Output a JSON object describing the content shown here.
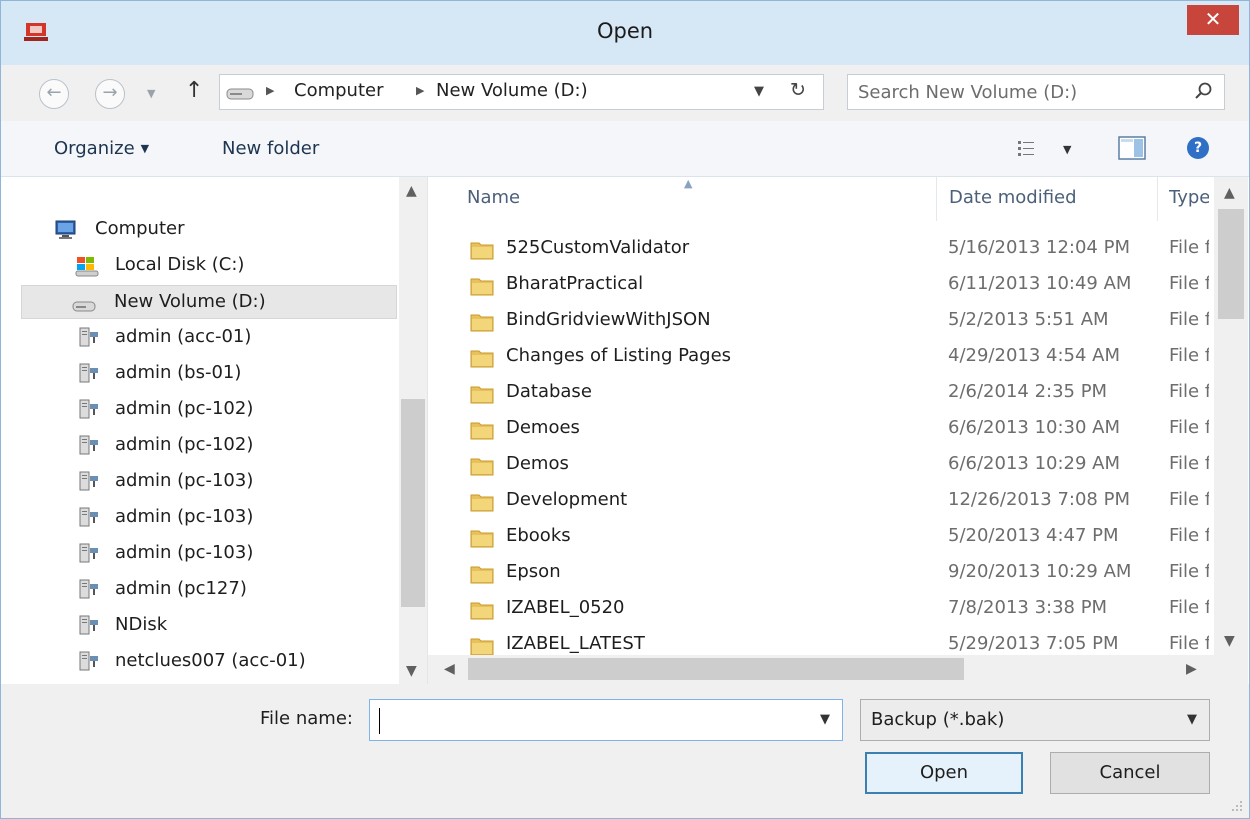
{
  "window": {
    "title": "Open",
    "close_glyph": "✕"
  },
  "addressbar": {
    "back_glyph": "←",
    "forward_glyph": "→",
    "up_glyph": "↑",
    "breadcrumbs": [
      "Computer",
      "New Volume (D:)"
    ],
    "search_placeholder": "Search New Volume (D:)",
    "refresh_glyph": "↻"
  },
  "toolbar": {
    "organize_label": "Organize",
    "new_folder_label": "New folder",
    "help_glyph": "?"
  },
  "navpane": {
    "items": [
      {
        "label": "Computer",
        "icon": "computer-icon",
        "selected": false
      },
      {
        "label": "Local Disk (C:)",
        "icon": "local-disk-icon",
        "selected": false
      },
      {
        "label": "New Volume (D:)",
        "icon": "drive-icon",
        "selected": true
      },
      {
        "label": "admin (acc-01)",
        "icon": "network-drive-icon",
        "selected": false
      },
      {
        "label": "admin (bs-01)",
        "icon": "network-drive-icon",
        "selected": false
      },
      {
        "label": "admin (pc-102)",
        "icon": "network-drive-icon",
        "selected": false
      },
      {
        "label": "admin (pc-102)",
        "icon": "network-drive-icon",
        "selected": false
      },
      {
        "label": "admin (pc-103)",
        "icon": "network-drive-icon",
        "selected": false
      },
      {
        "label": "admin (pc-103)",
        "icon": "network-drive-icon",
        "selected": false
      },
      {
        "label": "admin (pc-103)",
        "icon": "network-drive-icon",
        "selected": false
      },
      {
        "label": "admin (pc127)",
        "icon": "network-drive-icon",
        "selected": false
      },
      {
        "label": "NDisk",
        "icon": "network-drive-icon",
        "selected": false
      },
      {
        "label": "netclues007 (acc-01)",
        "icon": "network-drive-icon",
        "selected": false
      }
    ]
  },
  "filelist": {
    "columns": [
      "Name",
      "Date modified",
      "Type"
    ],
    "rows": [
      {
        "name": "525CustomValidator",
        "date": "5/16/2013 12:04 PM",
        "type": "File folder"
      },
      {
        "name": "BharatPractical",
        "date": "6/11/2013 10:49 AM",
        "type": "File folder"
      },
      {
        "name": "BindGridviewWithJSON",
        "date": "5/2/2013 5:51 AM",
        "type": "File folder"
      },
      {
        "name": "Changes of Listing Pages",
        "date": "4/29/2013 4:54 AM",
        "type": "File folder"
      },
      {
        "name": "Database",
        "date": "2/6/2014 2:35 PM",
        "type": "File folder"
      },
      {
        "name": "Demoes",
        "date": "6/6/2013 10:30 AM",
        "type": "File folder"
      },
      {
        "name": "Demos",
        "date": "6/6/2013 10:29 AM",
        "type": "File folder"
      },
      {
        "name": "Development",
        "date": "12/26/2013 7:08 PM",
        "type": "File folder"
      },
      {
        "name": "Ebooks",
        "date": "5/20/2013 4:47 PM",
        "type": "File folder"
      },
      {
        "name": "Epson",
        "date": "9/20/2013 10:29 AM",
        "type": "File folder"
      },
      {
        "name": "IZABEL_0520",
        "date": "7/8/2013 3:38 PM",
        "type": "File folder"
      },
      {
        "name": "IZABEL_LATEST",
        "date": "5/29/2013 7:05 PM",
        "type": "File folder"
      }
    ]
  },
  "bottom": {
    "file_name_label": "File name:",
    "file_name_value": "",
    "filter_value": "Backup (*.bak)",
    "open_label": "Open",
    "cancel_label": "Cancel"
  },
  "colors": {
    "titlebar": "#d6e7f6",
    "close": "#c7453b",
    "accent": "#3c7fb1",
    "folder": "#e8c15a"
  }
}
